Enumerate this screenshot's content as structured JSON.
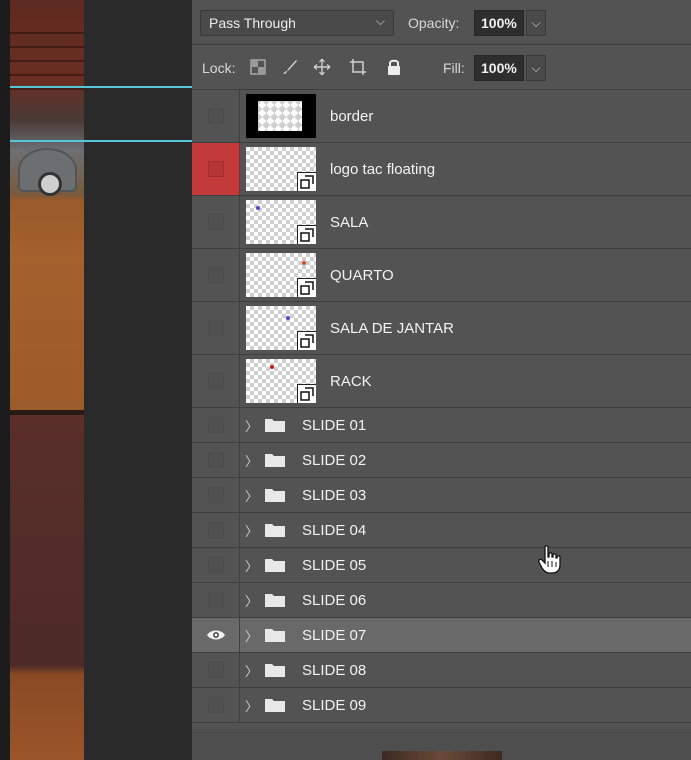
{
  "toolbar": {
    "blend_mode": "Pass Through",
    "opacity_label": "Opacity:",
    "opacity_value": "100%",
    "lock_label": "Lock:",
    "fill_label": "Fill:",
    "fill_value": "100%",
    "dropdown_chevron": "⌵"
  },
  "layers": [
    {
      "name": "border",
      "type": "raster-layer",
      "thumb": "black-frame",
      "visible": false,
      "highlighted": false
    },
    {
      "name": "logo tac floating",
      "type": "smart-object",
      "visible": false,
      "highlighted": true
    },
    {
      "name": "SALA",
      "type": "smart-object",
      "visible": false,
      "highlighted": false
    },
    {
      "name": "QUARTO",
      "type": "smart-object",
      "visible": false,
      "highlighted": false
    },
    {
      "name": "SALA DE JANTAR",
      "type": "smart-object",
      "visible": false,
      "highlighted": false
    },
    {
      "name": "RACK",
      "type": "smart-object",
      "visible": false,
      "highlighted": false
    }
  ],
  "groups": [
    {
      "name": "SLIDE 01",
      "visible": false,
      "selected": false
    },
    {
      "name": "SLIDE 02",
      "visible": false,
      "selected": false
    },
    {
      "name": "SLIDE 03",
      "visible": false,
      "selected": false
    },
    {
      "name": "SLIDE 04",
      "visible": false,
      "selected": false
    },
    {
      "name": "SLIDE 05",
      "visible": false,
      "selected": false
    },
    {
      "name": "SLIDE 06",
      "visible": false,
      "selected": false
    },
    {
      "name": "SLIDE 07",
      "visible": true,
      "selected": true
    },
    {
      "name": "SLIDE 08",
      "visible": false,
      "selected": false
    },
    {
      "name": "SLIDE 09",
      "visible": false,
      "selected": false
    }
  ],
  "icons": {
    "eye": "eye-icon",
    "folder": "folder-icon",
    "chevron": "chevron-right-icon",
    "smart_object": "smart-object-badge-icon",
    "cursor": "hand-pointer-cursor"
  },
  "colors": {
    "panel_bg": "#535353",
    "selected_row": "#696969",
    "highlight_red": "#c23a3a",
    "guide_cyan": "#58c6d6"
  }
}
